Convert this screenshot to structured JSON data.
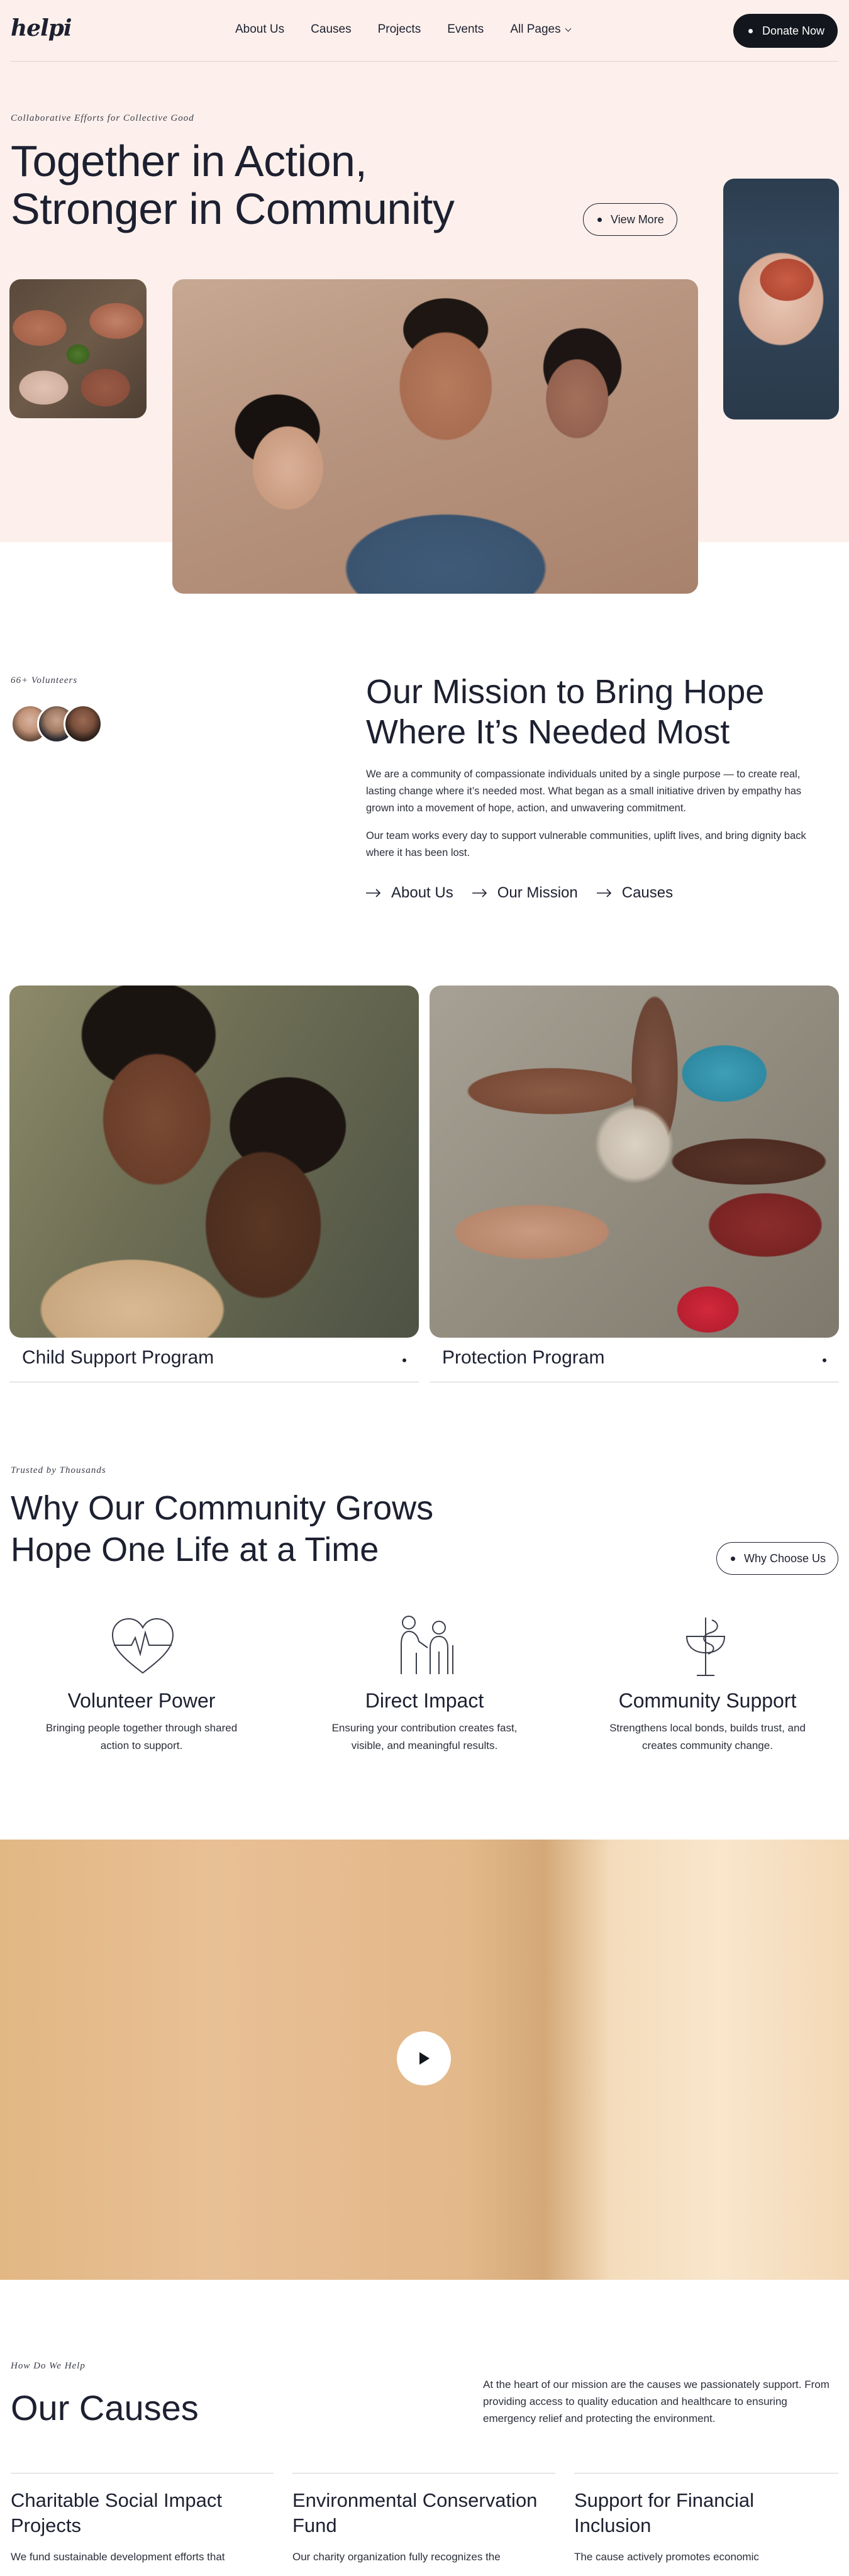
{
  "header": {
    "logo": "helpi",
    "nav": [
      "About Us",
      "Causes",
      "Projects",
      "Events",
      "All Pages"
    ],
    "donate_label": "Donate Now"
  },
  "hero": {
    "eyebrow": "Collaborative Efforts for Collective Good",
    "title_line1": "Together in Action,",
    "title_line2": "Stronger in Community",
    "view_more_label": "View More"
  },
  "mission": {
    "volunteers": "66+ Volunteers",
    "title_line1": "Our Mission to Bring Hope",
    "title_line2": "Where It’s Needed Most",
    "paragraph1": "We are a community of compassionate individuals united by a single purpose — to create real, lasting change where it’s needed most. What began as a small initiative driven by empathy has grown into a movement of hope, action, and unwavering commitment.",
    "paragraph2": "Our team works every day to support vulnerable communities, uplift lives, and bring dignity back where it has been lost.",
    "links": [
      "About Us",
      "Our Mission",
      "Causes"
    ]
  },
  "programs": [
    {
      "label": "Child Support Program"
    },
    {
      "label": "Protection Program"
    }
  ],
  "why": {
    "eyebrow": "Trusted by Thousands",
    "title_line1": "Why Our Community Grows",
    "title_line2": "Hope One Life at a Time",
    "button_label": "Why Choose Us",
    "features": [
      {
        "icon": "heartbeat-icon",
        "title": "Volunteer Power",
        "text_line1": "Bringing people together through shared",
        "text_line2": "action to support."
      },
      {
        "icon": "caregiver-icon",
        "title": "Direct Impact",
        "text_line1": "Ensuring your contribution creates fast,",
        "text_line2": "visible, and meaningful results."
      },
      {
        "icon": "medical-symbol-icon",
        "title": "Community Support",
        "text_line1": "Strengthens local bonds, builds trust, and",
        "text_line2": "creates community change."
      }
    ]
  },
  "video": {
    "play_icon": "play-icon"
  },
  "causes": {
    "eyebrow": "How Do We Help",
    "title": "Our Causes",
    "intro": "At the heart of our mission are the causes we passionately support. From providing access to quality education and healthcare to ensuring emergency relief and protecting the environment.",
    "items": [
      {
        "title_line1": "Charitable Social Impact",
        "title_line2": "Projects",
        "text": "We fund sustainable development efforts that"
      },
      {
        "title_line1": "Environmental Conservation",
        "title_line2": "Fund",
        "text": "Our charity organization fully recognizes the"
      },
      {
        "title_line1": "Support for Financial",
        "title_line2": "Inclusion",
        "text": "The cause actively promotes economic"
      }
    ]
  }
}
